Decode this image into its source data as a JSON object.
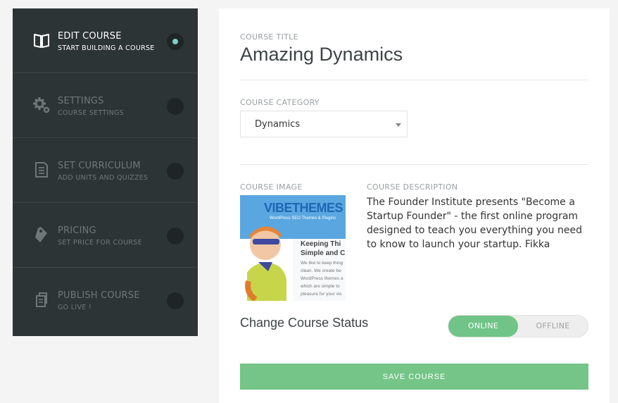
{
  "sidebar": {
    "steps": [
      {
        "title": "EDIT COURSE",
        "subtitle": "START BUILDING A COURSE",
        "icon": "book-icon",
        "active": true
      },
      {
        "title": "SETTINGS",
        "subtitle": "COURSE SETTINGS",
        "icon": "gear-icon",
        "active": false
      },
      {
        "title": "SET CURRICULUM",
        "subtitle": "ADD UNITS AND QUIZZES",
        "icon": "document-icon",
        "active": false
      },
      {
        "title": "PRICING",
        "subtitle": "SET PRICE FOR COURSE",
        "icon": "tag-icon",
        "active": false
      },
      {
        "title": "PUBLISH COURSE",
        "subtitle": "GO LIVE !",
        "icon": "publish-icon",
        "active": false
      }
    ],
    "active_dot_color": "#7bd0c4"
  },
  "main": {
    "course_title_label": "COURSE TITLE",
    "course_title": "Amazing Dynamics",
    "course_category_label": "COURSE CATEGORY",
    "course_category_value": "Dynamics",
    "course_image_label": "COURSE IMAGE",
    "course_image": {
      "logo_text": "VIBETHEMES",
      "tagline": "WordPress SEO Themes & Plugins",
      "heading_line1": "Keeping Thi",
      "heading_line2": "Simple and C",
      "body_lines": [
        "We like to keep thing",
        "clean. We create be",
        "WordPress themes a",
        "which are simple to",
        "pleasure for your vis"
      ]
    },
    "course_description_label": "COURSE DESCRIPTION",
    "course_description": "The Founder Institute presents \"Become a Startup Founder\" - the first online program designed to teach you everything you need to know to launch your startup. Fikka",
    "status_label": "Change Course Status",
    "status_online": "ONLINE",
    "status_offline": "OFFLINE",
    "status_selected": "ONLINE",
    "save_label": "SAVE COURSE",
    "accent_color": "#70c487"
  }
}
